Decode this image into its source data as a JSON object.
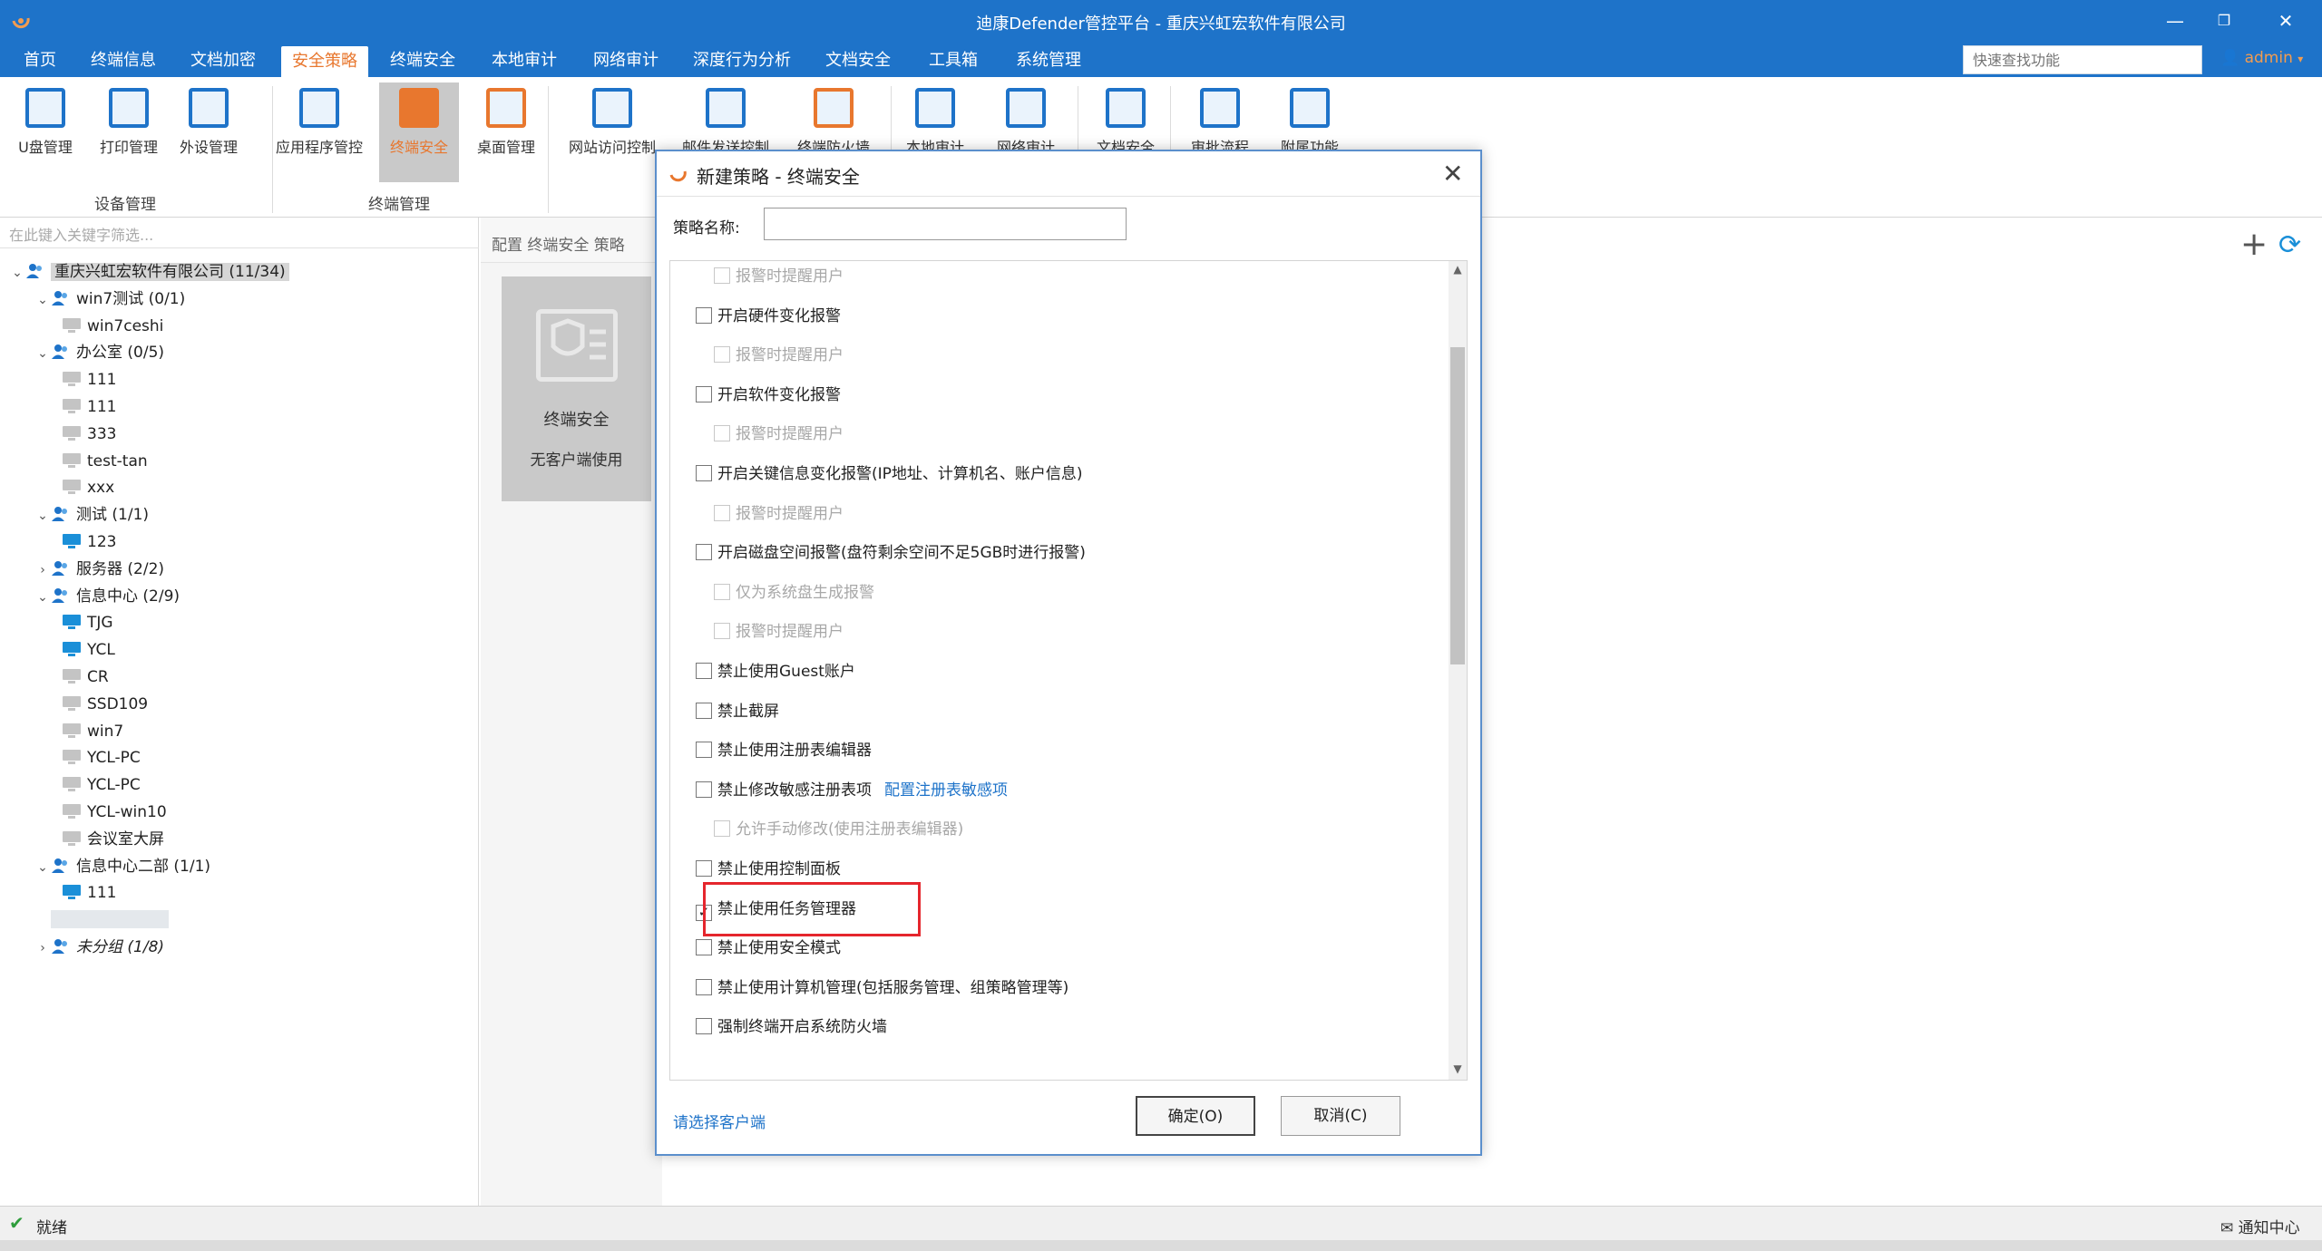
{
  "window": {
    "title": "迪康Defender管控平台 - 重庆兴虹宏软件有限公司"
  },
  "menu": {
    "items": [
      "首页",
      "终端信息",
      "文档加密",
      "安全策略",
      "终端安全",
      "本地审计",
      "网络审计",
      "深度行为分析",
      "文档安全",
      "工具箱",
      "系统管理"
    ],
    "active": "安全策略",
    "search_placeholder": "快速查找功能",
    "user": "admin"
  },
  "ribbon": {
    "buttons": [
      "U盘管理",
      "打印管理",
      "外设管理",
      "应用程序管控",
      "终端安全",
      "桌面管理",
      "网站访问控制",
      "邮件发送控制",
      "终端防火墙",
      "本地审计",
      "网络审计",
      "文档安全",
      "审批流程",
      "附属功能"
    ],
    "active": "终端安全",
    "groups": [
      "设备管理",
      "终端管理"
    ]
  },
  "tree": {
    "filter_placeholder": "在此键入关键字筛选...",
    "nodes": [
      {
        "label": "重庆兴虹宏软件有限公司 (11/34)",
        "level": 0,
        "type": "group",
        "expanded": true,
        "selected": true
      },
      {
        "label": "win7测试 (0/1)",
        "level": 1,
        "type": "group",
        "expanded": true
      },
      {
        "label": "win7ceshi",
        "level": 2,
        "type": "pc-offline"
      },
      {
        "label": "办公室 (0/5)",
        "level": 1,
        "type": "group",
        "expanded": true
      },
      {
        "label": "111",
        "level": 2,
        "type": "pc-offline"
      },
      {
        "label": "111",
        "level": 2,
        "type": "pc-offline"
      },
      {
        "label": "333",
        "level": 2,
        "type": "pc-offline"
      },
      {
        "label": "test-tan",
        "level": 2,
        "type": "pc-offline"
      },
      {
        "label": "xxx",
        "level": 2,
        "type": "pc-offline"
      },
      {
        "label": "测试 (1/1)",
        "level": 1,
        "type": "group",
        "expanded": true
      },
      {
        "label": "123",
        "level": 2,
        "type": "pc-online"
      },
      {
        "label": "服务器 (2/2)",
        "level": 1,
        "type": "group",
        "expanded": false
      },
      {
        "label": "信息中心 (2/9)",
        "level": 1,
        "type": "group",
        "expanded": true
      },
      {
        "label": "TJG",
        "level": 2,
        "type": "pc-online"
      },
      {
        "label": "YCL",
        "level": 2,
        "type": "pc-online"
      },
      {
        "label": "CR",
        "level": 2,
        "type": "pc-offline"
      },
      {
        "label": "SSD109",
        "level": 2,
        "type": "pc-offline"
      },
      {
        "label": "win7",
        "level": 2,
        "type": "pc-offline"
      },
      {
        "label": "YCL-PC",
        "level": 2,
        "type": "pc-offline"
      },
      {
        "label": "YCL-PC",
        "level": 2,
        "type": "pc-offline"
      },
      {
        "label": "YCL-win10",
        "level": 2,
        "type": "pc-offline"
      },
      {
        "label": "会议室大屏",
        "level": 2,
        "type": "pc-offline"
      },
      {
        "label": "信息中心二部 (1/1)",
        "level": 1,
        "type": "group",
        "expanded": true
      },
      {
        "label": "111",
        "level": 2,
        "type": "pc-online"
      },
      {
        "label": "",
        "level": 1,
        "type": "blurred"
      },
      {
        "label": "未分组 (1/8)",
        "level": 1,
        "type": "group",
        "expanded": false,
        "italic": true
      }
    ]
  },
  "middle": {
    "header": "配置 终端安全 策略",
    "card_title": "终端安全",
    "card_subtitle": "无客户端使用"
  },
  "dialog": {
    "title": "新建策略 - 终端安全",
    "name_label": "策略名称:",
    "name_value": "",
    "options": [
      {
        "label": "报警时提醒用户",
        "indent": true,
        "checked": false,
        "disabled": true
      },
      {
        "label": "开启硬件变化报警",
        "indent": false,
        "checked": false,
        "disabled": false
      },
      {
        "label": "报警时提醒用户",
        "indent": true,
        "checked": false,
        "disabled": true
      },
      {
        "label": "开启软件变化报警",
        "indent": false,
        "checked": false,
        "disabled": false
      },
      {
        "label": "报警时提醒用户",
        "indent": true,
        "checked": false,
        "disabled": true
      },
      {
        "label": "开启关键信息变化报警(IP地址、计算机名、账户信息)",
        "indent": false,
        "checked": false,
        "disabled": false
      },
      {
        "label": "报警时提醒用户",
        "indent": true,
        "checked": false,
        "disabled": true
      },
      {
        "label": "开启磁盘空间报警(盘符剩余空间不足5GB时进行报警)",
        "indent": false,
        "checked": false,
        "disabled": false
      },
      {
        "label": "仅为系统盘生成报警",
        "indent": true,
        "checked": false,
        "disabled": true
      },
      {
        "label": "报警时提醒用户",
        "indent": true,
        "checked": false,
        "disabled": true
      },
      {
        "label": "禁止使用Guest账户",
        "indent": false,
        "checked": false,
        "disabled": false
      },
      {
        "label": "禁止截屏",
        "indent": false,
        "checked": false,
        "disabled": false
      },
      {
        "label": "禁止使用注册表编辑器",
        "indent": false,
        "checked": false,
        "disabled": false
      },
      {
        "label": "禁止修改敏感注册表项",
        "indent": false,
        "checked": false,
        "disabled": false,
        "link": "配置注册表敏感项"
      },
      {
        "label": "允许手动修改(使用注册表编辑器)",
        "indent": true,
        "checked": false,
        "disabled": true
      },
      {
        "label": "禁止使用控制面板",
        "indent": false,
        "checked": false,
        "disabled": false
      },
      {
        "label": "禁止使用任务管理器",
        "indent": false,
        "checked": true,
        "disabled": false,
        "highlighted": true
      },
      {
        "label": "禁止使用安全模式",
        "indent": false,
        "checked": false,
        "disabled": false
      },
      {
        "label": "禁止使用计算机管理(包括服务管理、组策略管理等)",
        "indent": false,
        "checked": false,
        "disabled": false
      },
      {
        "label": "强制终端开启系统防火墙",
        "indent": false,
        "checked": false,
        "disabled": false
      }
    ],
    "select_client": "请选择客户端",
    "ok": "确定(O)",
    "cancel": "取消(C)"
  },
  "statusbar": {
    "status": "就绪",
    "notice": "通知中心"
  },
  "colors": {
    "accent": "#1e73c9",
    "active": "#e8772e",
    "highlight": "#e5262d",
    "online": "#1a8fd8"
  }
}
